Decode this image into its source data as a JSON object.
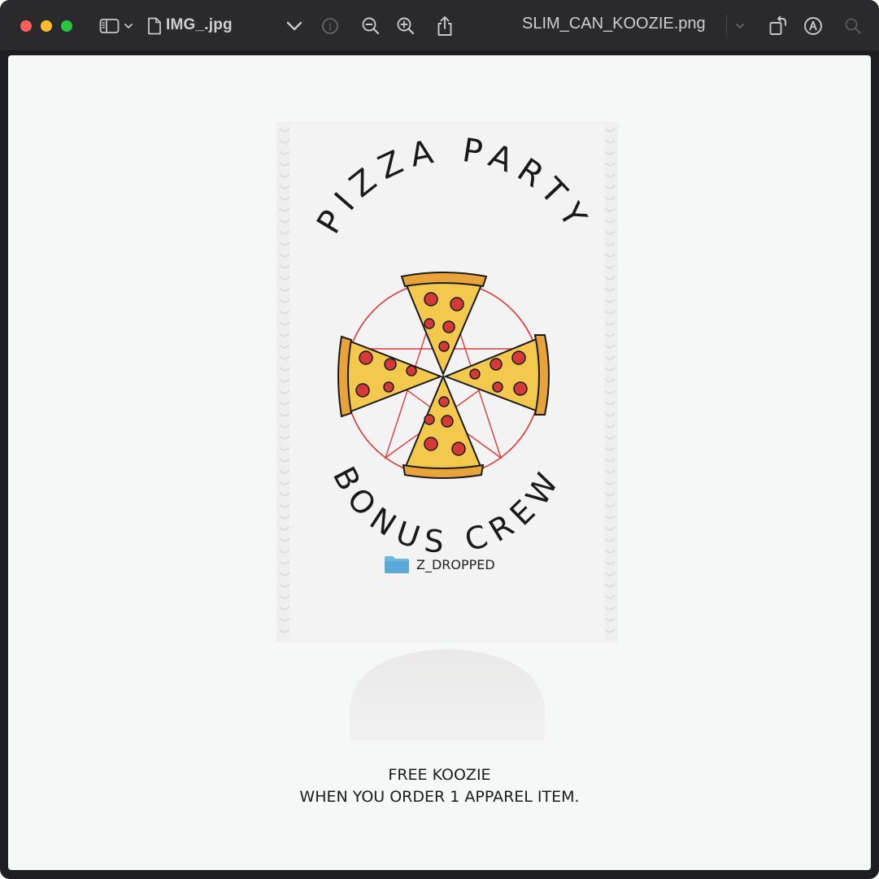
{
  "titlebar": {
    "document_name": "IMG_.jpg",
    "file_name": "SLIM_CAN_KOOZIE.png"
  },
  "icons": {
    "sidebar": "sidebar-toggle-icon",
    "document": "document-icon",
    "more": "chevron-down-icon",
    "info": "info-icon",
    "zoom_out": "zoom-out-icon",
    "zoom_in": "zoom-in-icon",
    "share": "share-icon",
    "rotate": "rotate-icon",
    "markup": "markup-icon",
    "search": "search-icon"
  },
  "artwork": {
    "top_text": "PIZZA PARTY",
    "bottom_text": "BONUS CREW"
  },
  "folder": {
    "label": "Z_DROPPED",
    "color": "#6bb8e3"
  },
  "caption": {
    "line1": "FREE KOOZIE",
    "line2": "WHEN YOU ORDER 1 APPAREL ITEM."
  },
  "colors": {
    "crust": "#e8a33a",
    "cheese": "#f2c94c",
    "pepperoni": "#d63a37",
    "circle": "#e03a3a"
  }
}
